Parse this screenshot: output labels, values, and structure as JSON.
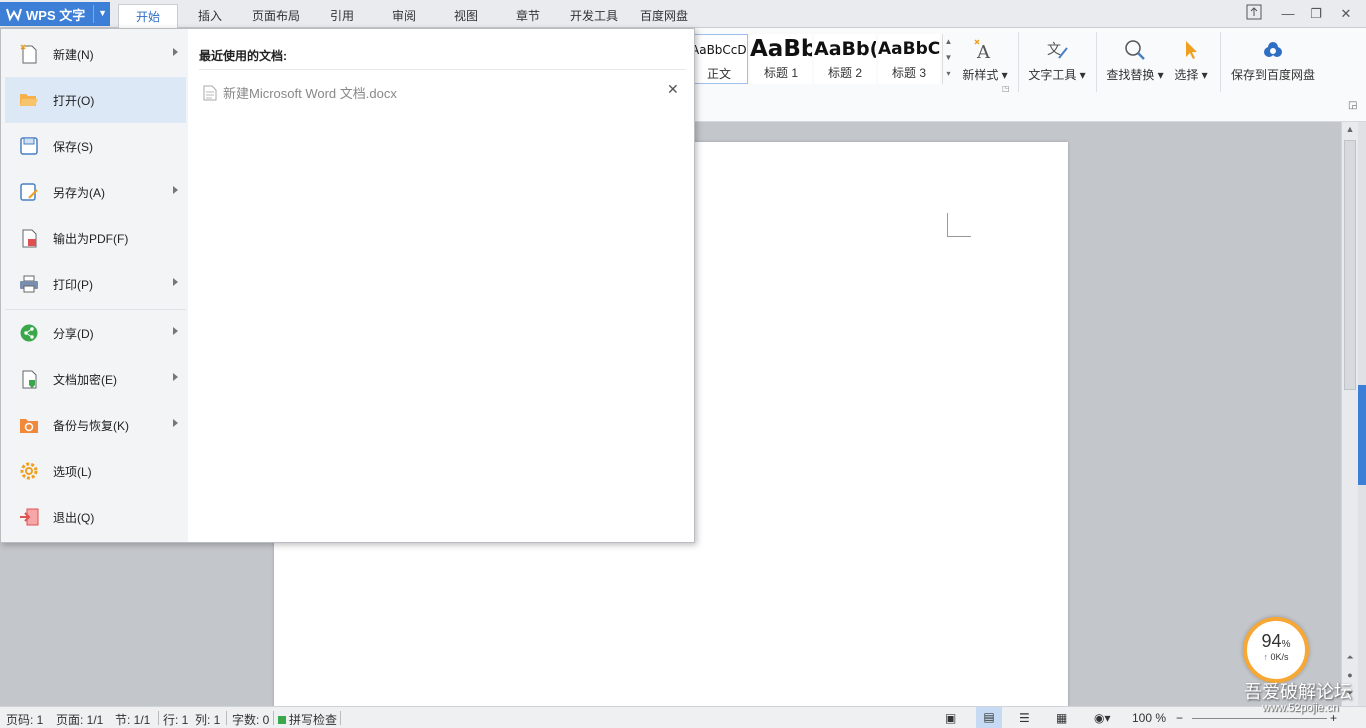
{
  "app": {
    "title": "WPS 文字"
  },
  "tabs": [
    {
      "label": "开始",
      "active": true
    },
    {
      "label": "插入"
    },
    {
      "label": "页面布局"
    },
    {
      "label": "引用"
    },
    {
      "label": "审阅"
    },
    {
      "label": "视图"
    },
    {
      "label": "章节"
    },
    {
      "label": "开发工具"
    },
    {
      "label": "百度网盘"
    }
  ],
  "ribbon": {
    "styles": [
      {
        "sample": "AaBbCcDd",
        "label": "正文"
      },
      {
        "sample": "AaBb",
        "label": "标题 1"
      },
      {
        "sample": "AaBb(",
        "label": "标题 2"
      },
      {
        "sample": "AaBbC",
        "label": "标题 3"
      }
    ],
    "new_style": "新样式",
    "text_tools": "文字工具",
    "find_replace": "查找替换",
    "select": "选择",
    "save_baidu": "保存到百度网盘"
  },
  "file_menu": {
    "items": [
      {
        "label": "新建(N)",
        "icon": "new-doc-icon",
        "submenu": true
      },
      {
        "label": "打开(O)",
        "icon": "folder-open-icon",
        "submenu": false,
        "hover": true
      },
      {
        "label": "保存(S)",
        "icon": "save-icon",
        "submenu": false
      },
      {
        "label": "另存为(A)",
        "icon": "save-as-icon",
        "submenu": true
      },
      {
        "label": "输出为PDF(F)",
        "icon": "pdf-icon",
        "submenu": false
      },
      {
        "label": "打印(P)",
        "icon": "printer-icon",
        "submenu": true
      },
      {
        "label": "分享(D)",
        "icon": "share-icon",
        "submenu": true
      },
      {
        "label": "文档加密(E)",
        "icon": "encrypt-icon",
        "submenu": true
      },
      {
        "label": "备份与恢复(K)",
        "icon": "backup-icon",
        "submenu": true
      },
      {
        "label": "选项(L)",
        "icon": "gear-icon",
        "submenu": false
      },
      {
        "label": "退出(Q)",
        "icon": "exit-icon",
        "submenu": false
      }
    ],
    "recent_title": "最近使用的文档:",
    "recent_docs": [
      {
        "name": "新建Microsoft Word 文档.docx"
      }
    ]
  },
  "status": {
    "page_code": "页码: 1",
    "pages": "页面: 1/1",
    "section": "节: 1/1",
    "row": "行: 1",
    "col": "列: 1",
    "words": "字数: 0",
    "spell": "拼写检查",
    "zoom": "100 %"
  },
  "network": {
    "percent": "94",
    "percent_unit": "%",
    "speed": "0K/s"
  },
  "watermark": {
    "text": "吾爱破解论坛",
    "url": "www.52pojie.cn"
  },
  "colors": {
    "accent": "#3d7fd6",
    "menu_hover": "#dde8f6",
    "widget_ring": "#f7a733"
  }
}
